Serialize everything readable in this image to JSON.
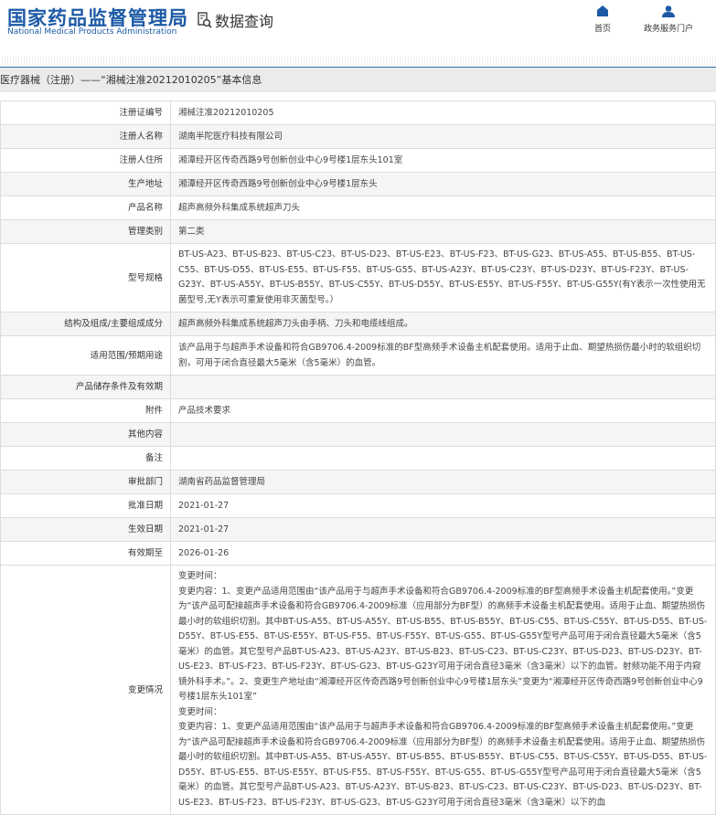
{
  "header": {
    "logo_cn": "国家药品监督管理局",
    "logo_en": "National Medical Products Administration",
    "section": "数据查询",
    "nav": [
      {
        "label": "首页",
        "icon": "home-icon"
      },
      {
        "label": "政务服务门户",
        "icon": "user-icon"
      }
    ]
  },
  "breadcrumb": "医疗器械（注册）——“湘械注准20212010205”基本信息",
  "rows": [
    {
      "label": "注册证编号",
      "value": "湘械注准20212010205"
    },
    {
      "label": "注册人名称",
      "value": "湖南半陀医疗科技有限公司"
    },
    {
      "label": "注册人住所",
      "value": "湘潭经开区传奇西路9号创新创业中心9号楼1层东头101室"
    },
    {
      "label": "生产地址",
      "value": "湘潭经开区传奇西路9号创新创业中心9号楼1层东头"
    },
    {
      "label": "产品名称",
      "value": "超声高频外科集成系统超声刀头"
    },
    {
      "label": "管理类别",
      "value": "第二类"
    },
    {
      "label": "型号规格",
      "value": "BT-US-A23、BT-US-B23、BT-US-C23、BT-US-D23、BT-US-E23、BT-US-F23、BT-US-G23、BT-US-A55、BT-US-B55、BT-US-C55、BT-US-D55、BT-US-E55、BT-US-F55、BT-US-G55、BT-US-A23Y、BT-US-C23Y、BT-US-D23Y、BT-US-F23Y、BT-US-G23Y、BT-US-A55Y、BT-US-B55Y、BT-US-C55Y、BT-US-D55Y、BT-US-E55Y、BT-US-F55Y、BT-US-G55Y(有Y表示一次性使用无菌型号,无Y表示可重复使用非灭菌型号。）"
    },
    {
      "label": "结构及组成/主要组成成分",
      "value": "超声高频外科集成系统超声刀头由手柄、刀头和电缆线组成。"
    },
    {
      "label": "适用范围/预期用途",
      "value": "该产品用于与超声手术设备和符合GB9706.4-2009标准的BF型高频手术设备主机配套使用。适用于止血、期望热损伤最小时的软组织切割，可用于闭合直径最大5毫米（含5毫米）的血管。"
    },
    {
      "label": "产品储存条件及有效期",
      "value": ""
    },
    {
      "label": "附件",
      "value": "产品技术要求"
    },
    {
      "label": "其他内容",
      "value": ""
    },
    {
      "label": "备注",
      "value": ""
    },
    {
      "label": "审批部门",
      "value": "湖南省药品监督管理局"
    },
    {
      "label": "批准日期",
      "value": "2021-01-27"
    },
    {
      "label": "生效日期",
      "value": "2021-01-27"
    },
    {
      "label": "有效期至",
      "value": "2026-01-26"
    }
  ],
  "changes": {
    "label": "变更情况",
    "entries": [
      {
        "time": "变更时间：",
        "content": "变更内容：1、变更产品适用范围由“该产品用于与超声手术设备和符合GB9706.4-2009标准的BF型高频手术设备主机配套使用。”变更为“该产品可配接超声手术设备和符合GB9706.4-2009标准（应用部分为BF型）的高频手术设备主机配套使用。适用于止血、期望热损伤最小时的软组织切割。其中BT-US-A55、BT-US-A55Y、BT-US-B55、BT-US-B55Y、BT-US-C55、BT-US-C55Y、BT-US-D55、BT-US-D55Y、BT-US-E55、BT-US-E55Y、BT-US-F55、BT-US-F55Y、BT-US-G55、BT-US-G55Y型号产品可用于闭合直径最大5毫米（含5毫米）的血管。其它型号产品BT-US-A23、BT-US-A23Y、BT-US-B23、BT-US-C23、BT-US-C23Y、BT-US-D23、BT-US-D23Y、BT-US-E23、BT-US-F23、BT-US-F23Y、BT-US-G23、BT-US-G23Y可用于闭合直径3毫米（含3毫米）以下的血管。射频功能不用于内窥镜外科手术。”。2、变更生产地址由“湘潭经开区传奇西路9号创新创业中心9号楼1层东头”变更为“湘潭经开区传奇西路9号创新创业中心9号楼1层东头101室”"
      },
      {
        "time": "变更时间：",
        "content": "变更内容：1、变更产品适用范围由“该产品用于与超声手术设备和符合GB9706.4-2009标准的BF型高频手术设备主机配套使用。”变更为“该产品可配接超声手术设备和符合GB9706.4-2009标准（应用部分为BF型）的高频手术设备主机配套使用。适用于止血、期望热损伤最小时的软组织切割。其中BT-US-A55、BT-US-A55Y、BT-US-B55、BT-US-B55Y、BT-US-C55、BT-US-C55Y、BT-US-D55、BT-US-D55Y、BT-US-E55、BT-US-E55Y、BT-US-F55、BT-US-F55Y、BT-US-G55、BT-US-G55Y型号产品可用于闭合直径最大5毫米（含5毫米）的血管。其它型号产品BT-US-A23、BT-US-A23Y、BT-US-B23、BT-US-C23、BT-US-C23Y、BT-US-D23、BT-US-D23Y、BT-US-E23、BT-US-F23、BT-US-F23Y、BT-US-G23、BT-US-G23Y可用于闭合直径3毫米（含3毫米）以下的血"
      }
    ]
  }
}
